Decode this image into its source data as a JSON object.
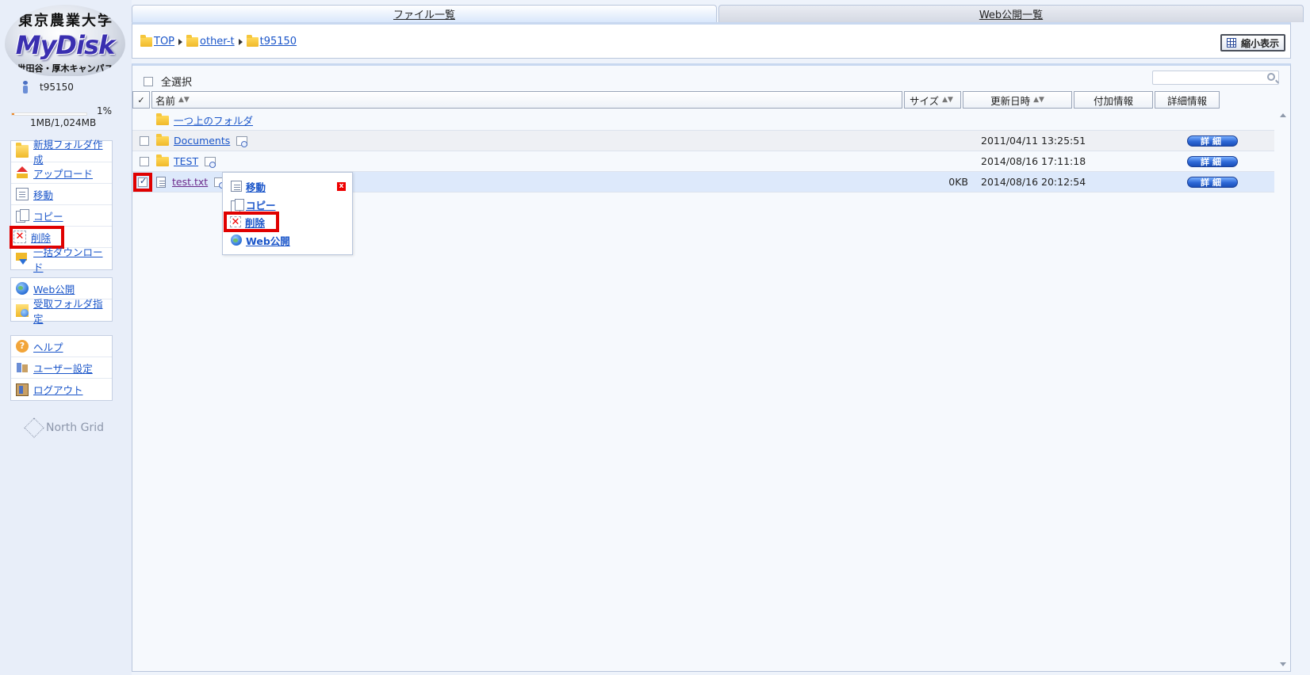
{
  "logo": {
    "university": "東京農業大学",
    "product": "MyDisk",
    "campus": "世田谷・厚木キャンパス"
  },
  "user": {
    "id": "t95150"
  },
  "quota": {
    "percent_label": "1%",
    "usage": "1MB/1,024MB",
    "fraction": 0.01
  },
  "sidebar": {
    "file_ops": [
      {
        "label": "新規フォルダ作成",
        "icon": "new-folder-icon"
      },
      {
        "label": "アップロード",
        "icon": "upload-icon"
      },
      {
        "label": "移動",
        "icon": "move-icon"
      },
      {
        "label": "コピー",
        "icon": "copy-icon"
      },
      {
        "label": "削除",
        "icon": "delete-icon",
        "highlighted": true
      },
      {
        "label": "一括ダウンロード",
        "icon": "download-icon"
      }
    ],
    "web_ops": [
      {
        "label": "Web公開",
        "icon": "globe-icon"
      },
      {
        "label": "受取フォルダ指定",
        "icon": "receive-folder-icon"
      }
    ],
    "account_ops": [
      {
        "label": "ヘルプ",
        "icon": "help-icon"
      },
      {
        "label": "ユーザー設定",
        "icon": "user-settings-icon"
      },
      {
        "label": "ログアウト",
        "icon": "logout-icon"
      }
    ],
    "footer_brand": "North Grid"
  },
  "tabs": [
    {
      "label": "ファイル一覧",
      "active": true
    },
    {
      "label": "Web公開一覧",
      "active": false
    }
  ],
  "breadcrumb": [
    "TOP",
    "other-t",
    "t95150"
  ],
  "shrink_button": "縮小表示",
  "select_all": "全選択",
  "search": {
    "placeholder": ""
  },
  "table": {
    "headers": {
      "check": "✓",
      "name": "名前",
      "size": "サイズ",
      "date": "更新日時",
      "extra": "付加情報",
      "detail": "詳細情報"
    },
    "sort_indicator": "▲▼",
    "rows": [
      {
        "name": "一つ上のフォルダ",
        "type": "parent",
        "size": "",
        "date": "",
        "checked": false
      },
      {
        "name": "Documents",
        "type": "folder",
        "size": "",
        "date": "2011/04/11 13:25:51",
        "checked": false
      },
      {
        "name": "TEST",
        "type": "folder",
        "size": "",
        "date": "2014/08/16 17:11:18",
        "checked": false
      },
      {
        "name": "test.txt",
        "type": "file",
        "size": "0KB",
        "date": "2014/08/16 20:12:54",
        "checked": true
      }
    ],
    "detail_button": "詳細"
  },
  "context_menu": {
    "items": [
      {
        "label": "移動",
        "icon": "move-icon"
      },
      {
        "label": "コピー",
        "icon": "copy-icon"
      },
      {
        "label": "削除",
        "icon": "delete-icon",
        "highlighted": true
      },
      {
        "label": "Web公開",
        "icon": "globe-icon"
      }
    ],
    "close": "x"
  },
  "colors": {
    "highlight": "#e00000",
    "link": "#1a55c9",
    "visited_link": "#6b2a8a",
    "detail_button": "#2d68d6"
  }
}
